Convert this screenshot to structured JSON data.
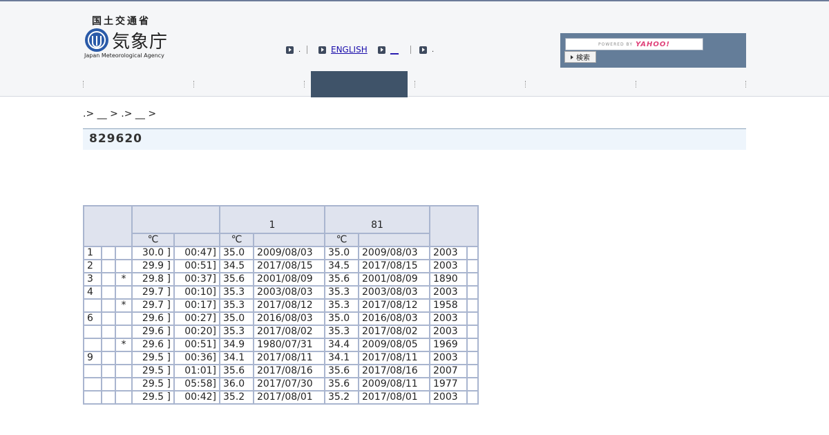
{
  "header": {
    "ministry": "国土交通省",
    "agency_jp": "気象庁",
    "agency_en": "Japan Meteorological Agency",
    "lang_links": [
      {
        "label": "",
        "link": false
      },
      {
        "label": "ENGLISH",
        "link": true
      },
      {
        "label": "__",
        "link": true
      },
      {
        "label": "",
        "link": false
      }
    ],
    "search": {
      "powered_by": "POWERED BY",
      "provider": "YAHOO!",
      "button": "検索"
    },
    "nav_tabs": [
      "",
      "",
      "",
      "",
      "",
      ""
    ],
    "active_tab_index": 2
  },
  "breadcrumb": ".> __ > .> __ >",
  "page_title": "829620",
  "table": {
    "group_headers": [
      "",
      "1",
      "81",
      ""
    ],
    "unit": "℃",
    "rows": [
      {
        "rank": "1",
        "mark": "",
        "temp": "30.0 ]",
        "time": "00:47]",
        "v1": "35.0",
        "d1": "2009/08/03",
        "v2": "35.0",
        "d2": "2009/08/03",
        "year": "2003"
      },
      {
        "rank": "2",
        "mark": "",
        "temp": "29.9 ]",
        "time": "00:51]",
        "v1": "34.5",
        "d1": "2017/08/15",
        "v2": "34.5",
        "d2": "2017/08/15",
        "year": "2003"
      },
      {
        "rank": "3",
        "mark": "*",
        "temp": "29.8 ]",
        "time": "00:37]",
        "v1": "35.6",
        "d1": "2001/08/09",
        "v2": "35.6",
        "d2": "2001/08/09",
        "year": "1890"
      },
      {
        "rank": "4",
        "mark": "",
        "temp": "29.7 ]",
        "time": "00:10]",
        "v1": "35.3",
        "d1": "2003/08/03",
        "v2": "35.3",
        "d2": "2003/08/03",
        "year": "2003"
      },
      {
        "rank": "",
        "mark": "*",
        "temp": "29.7 ]",
        "time": "00:17]",
        "v1": "35.3",
        "d1": "2017/08/12",
        "v2": "35.3",
        "d2": "2017/08/12",
        "year": "1958"
      },
      {
        "rank": "6",
        "mark": "",
        "temp": "29.6 ]",
        "time": "00:27]",
        "v1": "35.0",
        "d1": "2016/08/03",
        "v2": "35.0",
        "d2": "2016/08/03",
        "year": "2003"
      },
      {
        "rank": "",
        "mark": "",
        "temp": "29.6 ]",
        "time": "00:20]",
        "v1": "35.3",
        "d1": "2017/08/02",
        "v2": "35.3",
        "d2": "2017/08/02",
        "year": "2003"
      },
      {
        "rank": "",
        "mark": "*",
        "temp": "29.6 ]",
        "time": "00:51]",
        "v1": "34.9",
        "d1": "1980/07/31",
        "v2": "34.4",
        "d2": "2009/08/05",
        "year": "1969"
      },
      {
        "rank": "9",
        "mark": "",
        "temp": "29.5 ]",
        "time": "00:36]",
        "v1": "34.1",
        "d1": "2017/08/11",
        "v2": "34.1",
        "d2": "2017/08/11",
        "year": "2003"
      },
      {
        "rank": "",
        "mark": "",
        "temp": "29.5 ]",
        "time": "01:01]",
        "v1": "35.6",
        "d1": "2017/08/16",
        "v2": "35.6",
        "d2": "2017/08/16",
        "year": "2007"
      },
      {
        "rank": "",
        "mark": "",
        "temp": "29.5 ]",
        "time": "05:58]",
        "v1": "36.0",
        "d1": "2017/07/30",
        "v2": "35.6",
        "d2": "2009/08/11",
        "year": "1977"
      },
      {
        "rank": "",
        "mark": "",
        "temp": "29.5 ]",
        "time": "00:42]",
        "v1": "35.2",
        "d1": "2017/08/01",
        "v2": "35.2",
        "d2": "2017/08/01",
        "year": "2003"
      }
    ]
  },
  "colors": {
    "header_bg": "#f5f6f8",
    "active_tab": "#3f5369",
    "search_bg": "#647d99",
    "title_bg": "#eef5fc",
    "table_header_bg": "#dfe3ee",
    "table_border": "#a9b5cf"
  }
}
